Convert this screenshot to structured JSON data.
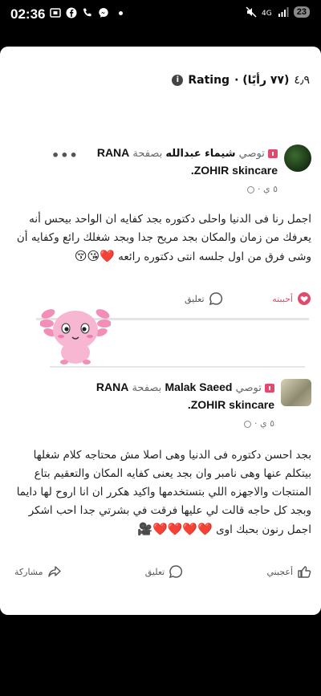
{
  "status_bar": {
    "time": "02:36",
    "badge": "23"
  },
  "rating": {
    "label": "Rating",
    "score": "٤٫٩",
    "count": "(٧٧ رأيًا) ·"
  },
  "posts": [
    {
      "author": "شيماء عبدالله",
      "recommends": "توصي",
      "preposition": "بصفحة",
      "page_line1": "RANA",
      "page_line2": "ZOHIR skincare.",
      "time": "٥ ي ·",
      "text": "اجمل رنا فى الدنيا واحلى دكتوره بجد كفايه ان الواحد بيحس أنه يعرفك من زمان  والمكان بجد مريح جدا  وبجد شغلك رائع  وكفايه أن  وشى فرق من اول جلسه   انتى دكتوره رائعه",
      "emojis": "❤️😘😚",
      "like_label": "أحببته",
      "comment_label": "تعليق"
    },
    {
      "author": "Malak Saeed",
      "recommends": "توصي",
      "preposition": "بصفحة",
      "page_line1": "RANA",
      "page_line2": "ZOHIR skincare.",
      "time": "٥ ي ·",
      "text": "بجد احسن دكتوره فى الدنيا وهى اصلا مش محتاجه كلام شغلها بيتكلم عنها  وهى نامبر وان بجد يعنى كفايه  المكان والتعقيم بتاع المنتجات والاجهزه اللي بتستخدمها واكيد هكرر ان انا اروح لها دايما وبجد كل حاجه قالت لي  عليها فرقت في بشرتي جدا احب اشكر اجمل رنون بحبك اوى",
      "emojis": "❤️❤️❤️❤️🎥",
      "like_label": "أعجبني",
      "comment_label": "تعليق",
      "share_label": "مشاركة"
    }
  ],
  "colors": {
    "accent_red": "#e24a6b",
    "mascot_pink": "#f4a6c7"
  }
}
